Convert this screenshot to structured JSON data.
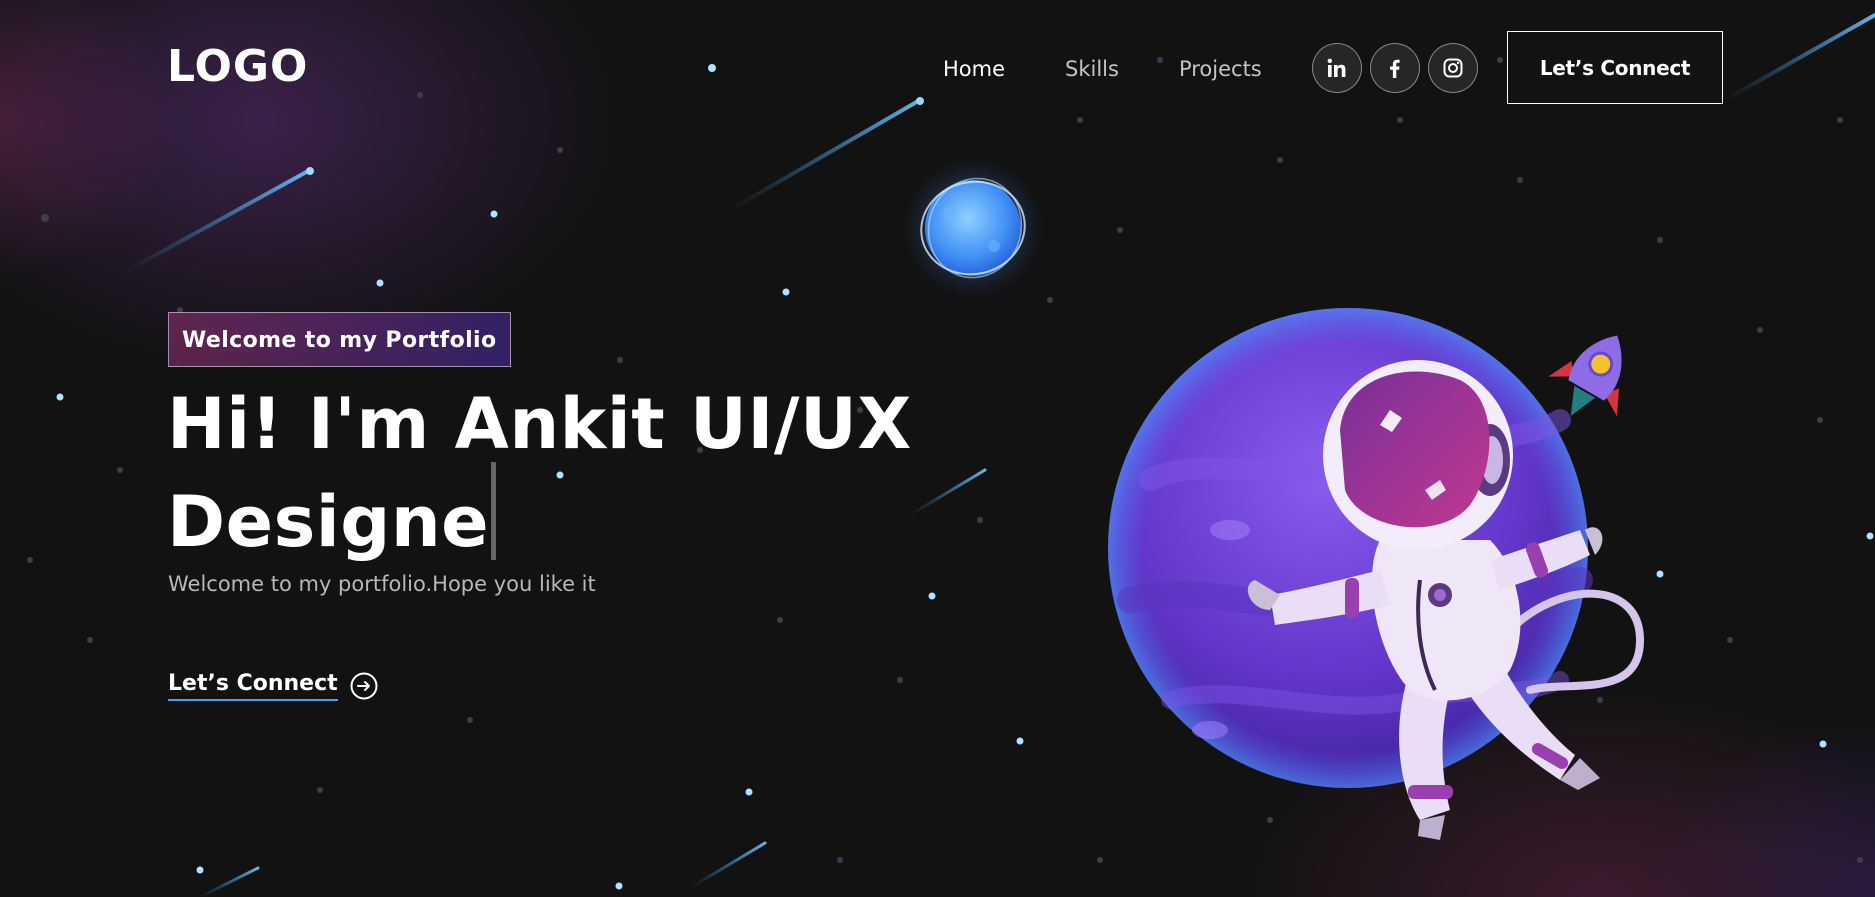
{
  "navbar": {
    "logo": "LOGO",
    "links": [
      {
        "label": "Home",
        "active": true
      },
      {
        "label": "Skills",
        "active": false
      },
      {
        "label": "Projects",
        "active": false
      }
    ],
    "social": [
      {
        "icon": "linkedin-icon"
      },
      {
        "icon": "facebook-icon"
      },
      {
        "icon": "instagram-icon"
      }
    ],
    "connect_label": "Let’s Connect"
  },
  "banner": {
    "tagline": "Welcome to my Portfolio",
    "headline_line1": "Hi! I'm Ankit UI/UX",
    "headline_line2": "Designe",
    "subtitle": "Welcome to my portfolio.Hope you like it",
    "connect_label": "Let’s Connect"
  },
  "colors": {
    "background": "#121212",
    "tagline_gradient_start": "#AA367C",
    "tagline_gradient_end": "#4A2FBD",
    "link_underline": "#4A9FE8",
    "planet": "#6B3FD1",
    "moon": "#4FA8FF"
  }
}
